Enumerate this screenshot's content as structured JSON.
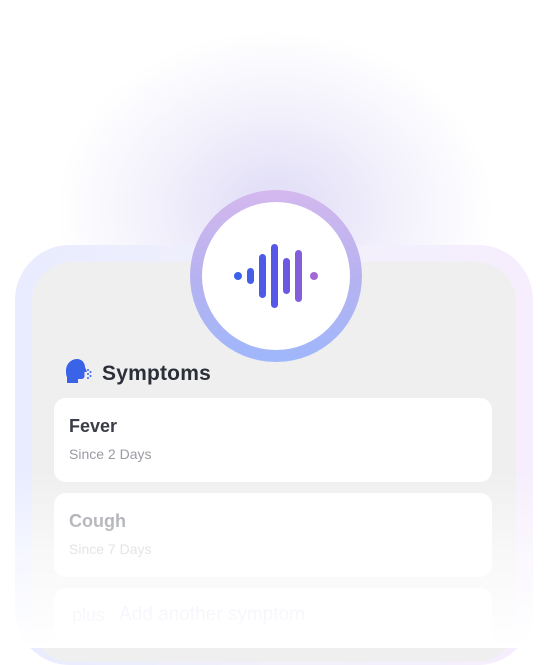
{
  "mic": {
    "icon": "voice-waveform-icon",
    "colors": [
      "#3b63e8",
      "#5b55e6",
      "#9b64d8"
    ]
  },
  "section": {
    "title": "Symptoms",
    "icon": "person-speaking-icon",
    "icon_color": "#3b63e8"
  },
  "symptoms": [
    {
      "name": "Fever",
      "since": "Since 2 Days"
    },
    {
      "name": "Cough",
      "since": "Since 7 Days"
    }
  ],
  "add": {
    "icon_text": "plus",
    "label": "Add another symptom"
  }
}
